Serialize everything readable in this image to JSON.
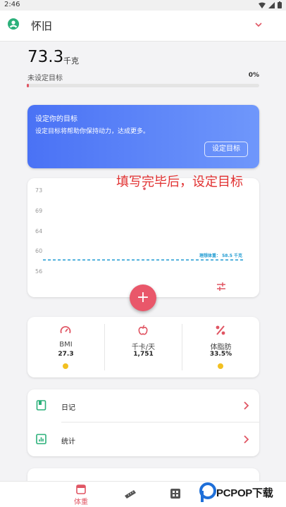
{
  "status_bar": {
    "time": "2:46"
  },
  "app_bar": {
    "title": "怀旧"
  },
  "weight": {
    "value": "73.3",
    "unit": "千克"
  },
  "goal": {
    "label": "未设定目标",
    "percent_text": "0%",
    "progress_fraction": 0.0
  },
  "goal_card": {
    "heading": "设定你的目标",
    "subtitle": "设定目标将帮助你保持动力，达成更多。",
    "button_label": "设定目标"
  },
  "annotation": "填写完毕后，设定目标",
  "chart_data": {
    "type": "line",
    "yticks": [
      "73",
      "69",
      "64",
      "60",
      "56"
    ],
    "ylim": [
      54,
      75
    ],
    "points": [
      {
        "y": 73.3
      }
    ],
    "reference_line": {
      "label": "理想体重：",
      "value": "58.5 千克",
      "y": 58.5
    }
  },
  "fab": {
    "label": "+"
  },
  "stats": [
    {
      "icon": "gauge-icon",
      "label": "BMI",
      "value": "27.3"
    },
    {
      "icon": "apple-icon",
      "label": "千卡/天",
      "value": "1,751"
    },
    {
      "icon": "percent-icon",
      "label": "体脂肪",
      "value": "33.5%"
    }
  ],
  "menu": [
    {
      "icon": "diary-icon",
      "label": "日记"
    },
    {
      "icon": "statistics-icon",
      "label": "统计"
    }
  ],
  "bottom_nav": {
    "weight_label": "体重"
  },
  "watermark": {
    "text": "PCPOP下载"
  },
  "colors": {
    "accent": "#e05563",
    "goal_gradient_start": "#4a72f5",
    "goal_gradient_end": "#6f97fb",
    "reference_line": "#1f9bd2",
    "menu_icon": "#2bb07a",
    "dot": "#f2c021"
  }
}
